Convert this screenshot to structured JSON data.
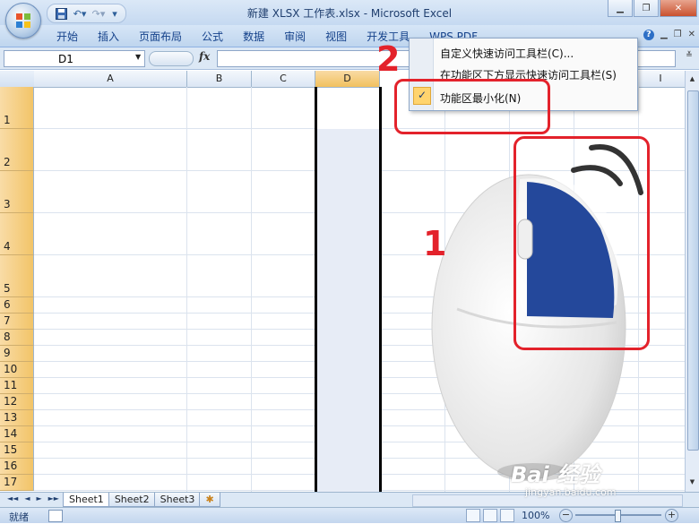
{
  "window": {
    "title": "新建 XLSX 工作表.xlsx - Microsoft Excel",
    "controls": [
      "minimize",
      "maximize",
      "close"
    ]
  },
  "quick_access": {
    "items": [
      "save-icon",
      "undo-icon",
      "redo-icon",
      "customize-icon"
    ]
  },
  "ribbon": {
    "tabs": [
      "开始",
      "插入",
      "页面布局",
      "公式",
      "数据",
      "审阅",
      "视图",
      "开发工具",
      "WPS PDF"
    ],
    "help_glyph": "?"
  },
  "formula_bar": {
    "name_box": "D1",
    "fx_label": "fx",
    "value": ""
  },
  "grid": {
    "columns": [
      "A",
      "B",
      "C",
      "D",
      "I"
    ],
    "selected_column": "D",
    "rows": [
      "1",
      "2",
      "3",
      "4",
      "5",
      "6",
      "7",
      "8",
      "9",
      "10",
      "11",
      "12",
      "13",
      "14",
      "15",
      "16",
      "17"
    ]
  },
  "context_menu": {
    "items": [
      {
        "label": "自定义快速访问工具栏(C)...",
        "checked": false
      },
      {
        "label": "在功能区下方显示快速访问工具栏(S)",
        "checked": false
      },
      {
        "label": "功能区最小化(N)",
        "checked": true
      }
    ],
    "check_glyph": "✓"
  },
  "annotations": {
    "step_1": "1",
    "step_2": "2",
    "color": "#e3222b"
  },
  "sheets": {
    "tabs": [
      "Sheet1",
      "Sheet2",
      "Sheet3"
    ],
    "active": "Sheet1",
    "nav": [
      "◄◄",
      "◄",
      "►",
      "►►"
    ]
  },
  "status": {
    "text": "就绪",
    "zoom": "100%",
    "zoom_out": "−",
    "zoom_in": "+"
  },
  "watermark": {
    "logo": "Bai 经验",
    "url": "jingyan.baidu.com"
  },
  "colors": {
    "ribbon_tab_text": "#15428b",
    "row_header": "#f2c468",
    "accent_red": "#e3222b"
  }
}
